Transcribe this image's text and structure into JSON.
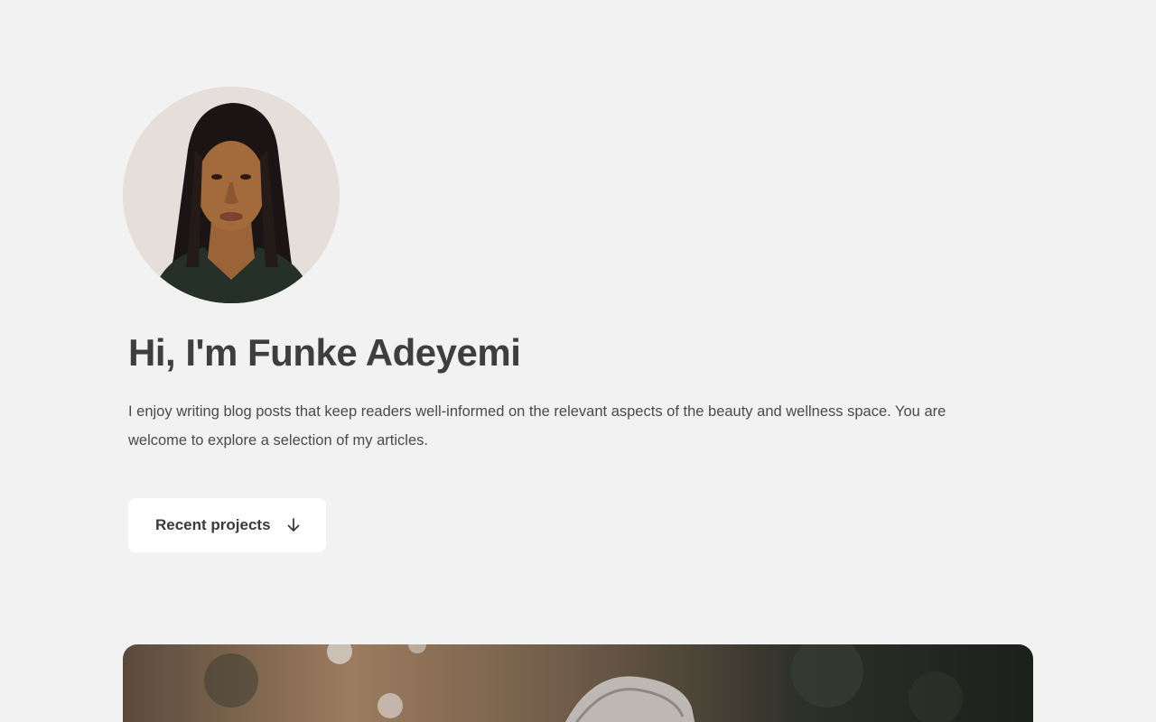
{
  "profile": {
    "avatar_icon": "profile-photo",
    "headline": "Hi, I'm Funke Adeyemi",
    "intro": "I enjoy writing blog posts that keep readers well-informed on the relevant aspects of the beauty and wellness space. You are welcome to explore a selection of my articles."
  },
  "cta": {
    "label": "Recent projects",
    "icon": "arrow-down-icon"
  },
  "featured": {
    "image_icon": "featured-project-image"
  },
  "colors": {
    "background": "#f2f2f2",
    "text": "#3e3e3e",
    "button_bg": "#ffffff"
  }
}
